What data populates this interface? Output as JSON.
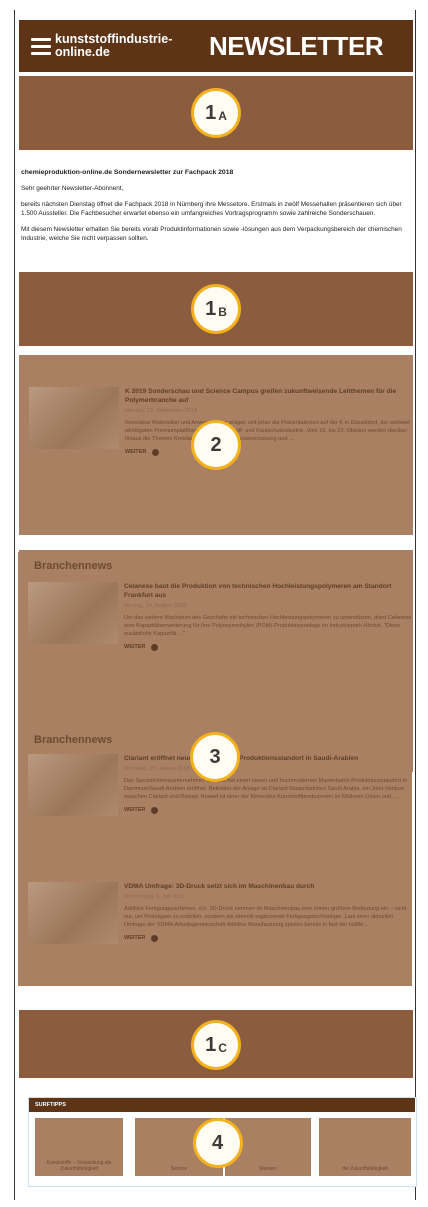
{
  "header": {
    "logo_line1": "kunststoffindustrie-",
    "logo_line2": "online.de",
    "title": "NEWSLETTER"
  },
  "badges": {
    "b1a": {
      "num": "1",
      "sub": "A"
    },
    "b1b": {
      "num": "1",
      "sub": "B"
    },
    "b2": {
      "num": "2"
    },
    "b3": {
      "num": "3"
    },
    "b1c": {
      "num": "1",
      "sub": "C"
    },
    "b4": {
      "num": "4"
    }
  },
  "intro": {
    "heading": "chemieproduktion-online.de Sondernewsletter zur Fachpack 2018",
    "greeting": "Sehr geehrter Newsletter-Abonnent,",
    "para1": "bereits nächsten Dienstag öffnet die Fachpack 2018 in Nürnberg ihre Messetore. Erstmals in zwölf Messehallen präsentieren sich über 1.500 Aussteller. Die Fachbesucher erwartet ebenso ein umfangreiches Vortragsprogramm sowie zahlreiche Sonderschauen.",
    "para2": "Mit diesem Newsletter erhalten Sie bereits vorab Produktinformationen sowie -lösungen aus dem Verpackungsbereich der chemischen Industrie, welche Sie nicht verpassen sollten."
  },
  "section2": {
    "article": {
      "title": "K 2019 Sonderschau und Science Campus greifen zukunftweisende Leitthemen für die Polymerbranche auf",
      "date": "Montag, 23. September 2018",
      "body": "Innovative Materialien und Anwendungen prägen seit jeher die Präsentationen auf der K in Düsseldorf, der weltweit wichtigsten Premiumplattform für die Kunststoff- und Kautschukindustrie. Vom 16. bis 23. Oktober werden darüber hinaus die Themen Kreislaufwirtschaft, Ressourcenschonung und ...",
      "more": "WEITER"
    }
  },
  "section3": {
    "label1": "Branchennews",
    "label2": "Branchennews",
    "articles": [
      {
        "title": "Celanese baut die Produktion von technischen Hochleistungspolymeren am Standort Frankfurt aus",
        "date": "Montag, 24. August 2018",
        "body": "Um das weitere Wachstum des Geschäfts mit technischen Hochleistungspolymeren zu unterstützen, plant Celanese eine Kapazitätserweiterung für ihre Polyoxymethylen (POM)-Produktionsanlage im Industriepark Höchst. \"Diese zusätzliche Kapazität ...\"",
        "more": "WEITER"
      },
      {
        "title": "Clariant eröffnet neuen Masterbatch-Produktionsstandort in Saudi-Arabien",
        "date": "Dienstag, 25. Januar 2018",
        "body": "Das Spezialchemieunternehmen Clariant hat einen neuen und hochmodernen Masterbatch-Produktionsstandort in Dammam/Saudi-Arabien eröffnet. Betreiber der Anlage ist Clariant Masterbatches Saudi Arabia, ein Joint-Venture zwischen Clariant und Rowad. Rowad ist einer der führenden Kunststoffproduzenten im Mittleren Osten und ...",
        "more": "WEITER"
      },
      {
        "title": "VDMA Umfrage: 3D-Druck setzt sich im Maschinenbau durch",
        "date": "Donnerstag, 5. Juli 2018",
        "body": "Additive Fertigungsverfahren, d.h. 3D-Druck nehmen im Maschinenbau eine immer größere Bedeutung ein – nicht nur, um Prototypen zu erstellen, sondern als sinnvoll ergänzende Fertigungstechnologie. Laut einer aktuellen Umfrage der VDMA-Arbeitsgemeinschaft Additive Manufacturing spielen bereits in fast der Hälfte ...",
        "more": "WEITER"
      }
    ]
  },
  "surf": {
    "head": "SURFTIPPS",
    "cards": [
      {
        "cap": "Kunststoffe – Verpackung die Zukunftsfähigkeit"
      },
      {
        "cap": "Service"
      },
      {
        "cap": "Messen"
      },
      {
        "cap": "die Zukunftsfähigkeit"
      }
    ]
  }
}
